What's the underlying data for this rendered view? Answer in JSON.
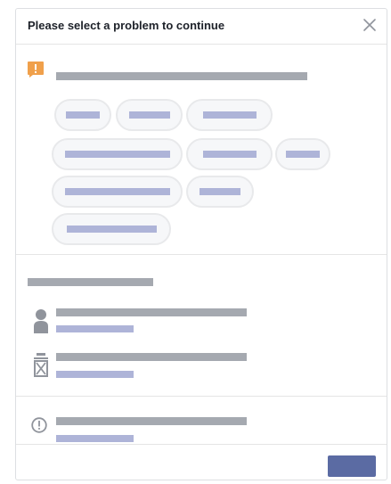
{
  "dialog": {
    "title": "Please select a problem to continue"
  },
  "colors": {
    "warning_icon": "#f0a04b",
    "placeholder_bar": "#a5a9b0",
    "placeholder_subbar": "#aeb4d8",
    "pill_fill": "#f6f7f9",
    "pill_border": "#e8e9eb",
    "primary_button": "#5b6ba3",
    "icon_gray": "#90949c"
  },
  "icons": {
    "header_close": "close-icon",
    "problem_section": "warning-icon",
    "row_1": "person-icon",
    "row_2": "delete-icon",
    "info_row": "info-icon"
  }
}
